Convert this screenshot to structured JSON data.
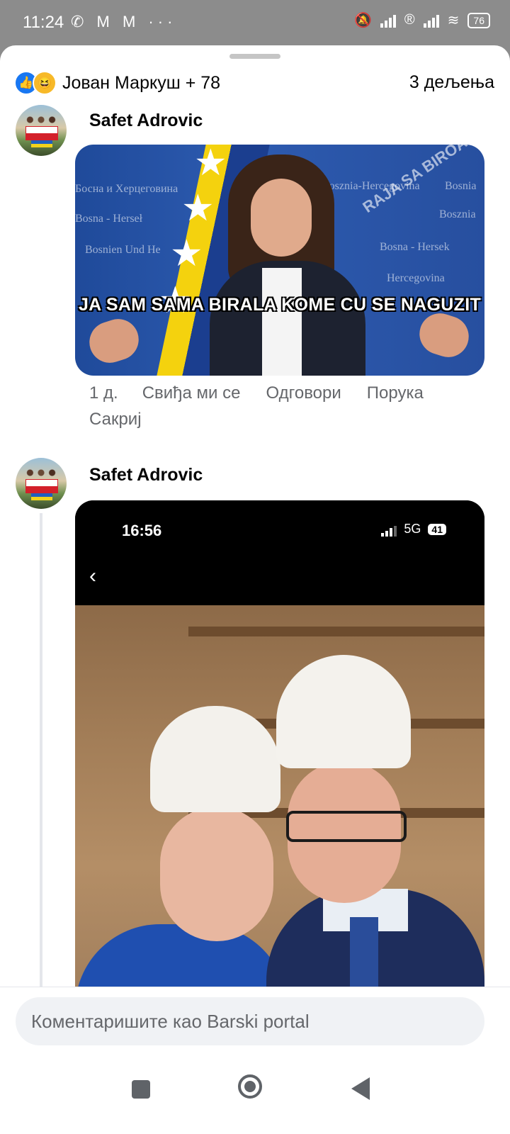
{
  "status_bar": {
    "time": "11:24",
    "left_icons": "✆ M M ···",
    "battery": "76"
  },
  "header": {
    "reactors": "Јован Маркуш + 78",
    "shares": "3 дељења"
  },
  "comments": [
    {
      "author": "Safet Adrovic",
      "image_caption": "JA SAM SAMA BIRALA KOME CU SE NAGUZIT",
      "image_watermark": "RAJA SA BIROA",
      "image_bg_texts": [
        "Bosznia-Hercegovina",
        "Bosnia",
        "Bosna - Hersek",
        "Bosnien Und He",
        "Bosna - Hersek",
        "Hercegovina",
        "Босна и Херцеговина",
        "Bosna - Herseł",
        "Bosznia"
      ],
      "time": "1 д.",
      "like": "Свиђа ми се",
      "reply": "Одговори",
      "message": "Порука",
      "hide": "Сакриј"
    },
    {
      "author": "Safet Adrovic",
      "phone_time": "16:56",
      "phone_network": "5G",
      "phone_battery": "41",
      "back": "‹"
    }
  ],
  "composer": {
    "placeholder": "Коментаришите као Barski portal"
  },
  "nav": {
    "recents": "recents",
    "home": "home",
    "back": "back"
  }
}
